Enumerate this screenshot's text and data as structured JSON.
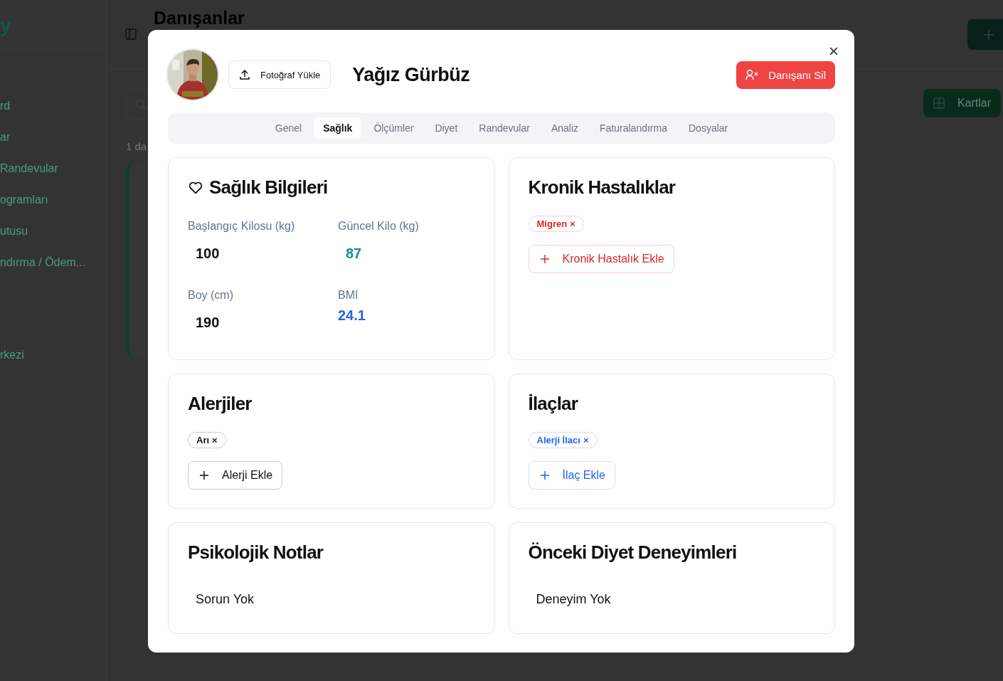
{
  "background": {
    "logo": "y",
    "nav": [
      {
        "label": "rd"
      },
      {
        "label": "ar"
      },
      {
        "label": "Randevular"
      },
      {
        "label": "ogramları"
      },
      {
        "label": "utusu"
      },
      {
        "label": "ndırma / Ödem..."
      }
    ],
    "nav_footer": "rkezi",
    "title": "Danışanlar",
    "count": "1 da",
    "view_button": "Kartlar"
  },
  "modal": {
    "close": "×",
    "upload_button": "Fotoğraf Yükle",
    "name": "Yağız Gürbüz",
    "delete_button": "Danışanı Sil",
    "tabs": [
      {
        "label": "Genel",
        "selected": false
      },
      {
        "label": "Sağlık",
        "selected": true
      },
      {
        "label": "Ölçümler",
        "selected": false
      },
      {
        "label": "Diyet",
        "selected": false
      },
      {
        "label": "Randevular",
        "selected": false
      },
      {
        "label": "Analiz",
        "selected": false
      },
      {
        "label": "Faturalandırma",
        "selected": false
      },
      {
        "label": "Dosyalar",
        "selected": false
      }
    ],
    "cards": [
      {
        "kind": "metrics",
        "title": "Sağlık Bilgileri",
        "fields": [
          {
            "label": "Başlangıç Kilosu (kg)",
            "value": "100",
            "color": "#111111"
          },
          {
            "label": "Güncel Kilo (kg)",
            "value": "87",
            "color": "#0d9488"
          },
          {
            "label": "Boy (cm)",
            "value": "190",
            "color": "#111111"
          },
          {
            "label": "BMI",
            "value": "24.1",
            "color": "#2563eb"
          }
        ]
      },
      {
        "kind": "tags",
        "title": "Kronik Hastalıklar",
        "color": "#dc2626",
        "tags": [
          {
            "label": "Migren",
            "remove": "×"
          }
        ],
        "add_button": "Kronik Hastalık Ekle"
      },
      {
        "kind": "tags",
        "title": "Alerjiler",
        "color": "#111111",
        "tags": [
          {
            "label": "Arı",
            "remove": "×"
          }
        ],
        "add_button": "Alerji Ekle"
      },
      {
        "kind": "tags",
        "title": "İlaçlar",
        "color": "#2563eb",
        "tags": [
          {
            "label": "Alerji İlacı",
            "remove": "×"
          }
        ],
        "add_button": "İlaç Ekle"
      },
      {
        "kind": "text",
        "title": "Psikolojik Notlar",
        "text": "Sorun Yok"
      },
      {
        "kind": "text",
        "title": "Önceki Diyet Deneyimleri",
        "text": "Deneyim Yok"
      }
    ]
  }
}
